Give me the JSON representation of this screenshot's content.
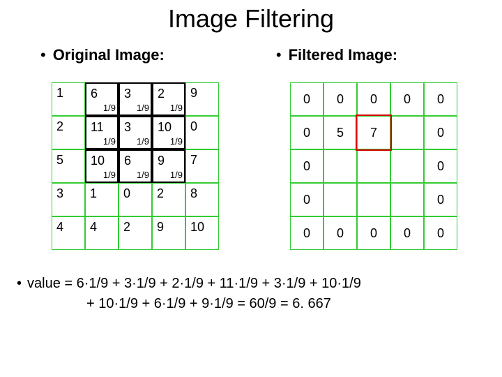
{
  "title": "Image Filtering",
  "original_label": "Original Image:",
  "filtered_label": "Filtered Image:",
  "bullet": "•",
  "kernel_factor": "1/9",
  "original": [
    [
      "1",
      "6",
      "3",
      "2",
      "9"
    ],
    [
      "2",
      "11",
      "3",
      "10",
      "0"
    ],
    [
      "5",
      "10",
      "6",
      "9",
      "7"
    ],
    [
      "3",
      "1",
      "0",
      "2",
      "8"
    ],
    [
      "4",
      "4",
      "2",
      "9",
      "10"
    ]
  ],
  "original_kernel_positions": [
    [
      0,
      1
    ],
    [
      0,
      2
    ],
    [
      0,
      3
    ],
    [
      1,
      1
    ],
    [
      1,
      2
    ],
    [
      1,
      3
    ],
    [
      2,
      1
    ],
    [
      2,
      2
    ],
    [
      2,
      3
    ]
  ],
  "filtered": [
    [
      "0",
      "0",
      "0",
      "0",
      "0"
    ],
    [
      "0",
      "5",
      "7",
      "",
      "0"
    ],
    [
      "0",
      "",
      "",
      "",
      "0"
    ],
    [
      "0",
      "",
      "",
      "",
      "0"
    ],
    [
      "0",
      "0",
      "0",
      "0",
      "0"
    ]
  ],
  "filtered_highlight": [
    1,
    2
  ],
  "equation_line1": "value = 6·1/9 + 3·1/9 + 2·1/9 + 11·1/9 + 3·1/9 + 10·1/9",
  "equation_line2": "+ 10·1/9 + 6·1/9 + 9·1/9 = 60/9 = 6. 667",
  "chart_data": {
    "type": "table",
    "title": "Image Filtering — 3x3 mean kernel (1/9) applied",
    "original_image": [
      [
        1,
        6,
        3,
        2,
        9
      ],
      [
        2,
        11,
        3,
        10,
        0
      ],
      [
        5,
        10,
        6,
        9,
        7
      ],
      [
        3,
        1,
        0,
        2,
        8
      ],
      [
        4,
        4,
        2,
        9,
        10
      ]
    ],
    "kernel": [
      [
        0.1111,
        0.1111,
        0.1111
      ],
      [
        0.1111,
        0.1111,
        0.1111
      ],
      [
        0.1111,
        0.1111,
        0.1111
      ]
    ],
    "filtered_image_partial": [
      [
        0,
        0,
        0,
        0,
        0
      ],
      [
        0,
        5,
        7,
        null,
        0
      ],
      [
        0,
        null,
        null,
        null,
        0
      ],
      [
        0,
        null,
        null,
        null,
        0
      ],
      [
        0,
        0,
        0,
        0,
        0
      ]
    ],
    "example_computation": {
      "window_values": [
        6,
        3,
        2,
        11,
        3,
        10,
        10,
        6,
        9
      ],
      "sum": 60,
      "divisor": 9,
      "result": 6.667,
      "output_cell": [
        1,
        2
      ]
    }
  }
}
